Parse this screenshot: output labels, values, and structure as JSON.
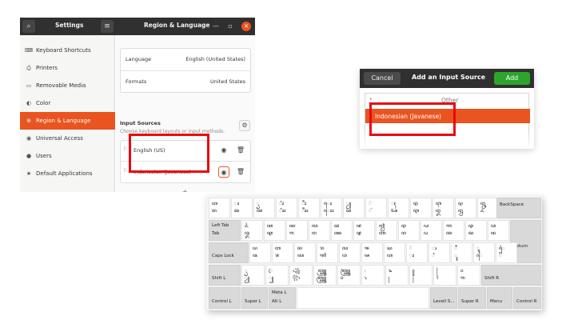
{
  "settings": {
    "header": {
      "left_title": "Settings",
      "right_title": "Region & Language",
      "search_glyph": "⌕",
      "menu_glyph": "≡",
      "minimize_glyph": "—",
      "maximize_glyph": "▫",
      "close_glyph": "✕"
    },
    "sidebar": {
      "items": [
        {
          "icon": "keyboard-icon",
          "glyph": "⌨",
          "label": "Keyboard Shortcuts"
        },
        {
          "icon": "printer-icon",
          "glyph": "⎙",
          "label": "Printers"
        },
        {
          "icon": "removable-media-icon",
          "glyph": "▭",
          "label": "Removable Media"
        },
        {
          "icon": "color-icon",
          "glyph": "◐",
          "label": "Color"
        },
        {
          "icon": "region-language-icon",
          "glyph": "⊕",
          "label": "Region & Language"
        },
        {
          "icon": "universal-access-icon",
          "glyph": "◉",
          "label": "Universal Access"
        },
        {
          "icon": "users-icon",
          "glyph": "●",
          "label": "Users"
        },
        {
          "icon": "default-applications-icon",
          "glyph": "★",
          "label": "Default Applications"
        }
      ],
      "active_index": 4
    },
    "language_row": {
      "label": "Language",
      "value": "English (United States)"
    },
    "formats_row": {
      "label": "Formats",
      "value": "United States"
    },
    "input_sources": {
      "title": "Input Sources",
      "subtitle": "Choose keyboard layouts or input methods.",
      "options_glyph": "⚙",
      "drag_glyph": "⠿",
      "sources": [
        {
          "name": "English (US)",
          "eye_glyph": "◉",
          "trash_glyph": "🗑"
        },
        {
          "name": "Indonesian (Javanese)",
          "eye_glyph": "◉",
          "trash_glyph": "🗑"
        }
      ],
      "add_glyph": "+"
    }
  },
  "dialog": {
    "cancel_label": "Cancel",
    "title": "Add an Input Source",
    "add_label": "Add",
    "back_glyph": "‹",
    "other_label": "Other",
    "selected_item": "Indonesian (Javanese)"
  },
  "keyboard": {
    "labels": {
      "backspace": "BackSpace",
      "tab_top": "Left Tab",
      "tab_bottom": "Tab",
      "return": "Return",
      "caps": "Caps Lock",
      "shift_l": "Shift L",
      "shift_r": "Shift R",
      "ctrl_l": "Control L",
      "super_l": "Super L",
      "meta_top": "Meta L",
      "meta_bottom": "Alt L",
      "level3": "LevelI S...",
      "super_r": "Super R",
      "menu": "Menu",
      "ctrl_r": "Control R"
    },
    "row1": [
      [
        "ꦲ",
        "ꦩ"
      ],
      [
        "ꦴ",
        "ꦢ"
      ],
      [
        "ꦽ",
        "ꦠ"
      ],
      [
        "ꦶꦴ",
        "ꦶꦴꦴ"
      ],
      [
        "ꦷꦴ",
        "ꦷꦴꦴ"
      ],
      [
        "ꦺꦴ",
        "ꦺꦴꦴ"
      ],
      [
        "ꦾ",
        "ꦕ"
      ],
      [
        "ꦁ",
        "ꦂ"
      ],
      [
        "ꦃ",
        "ꦄ"
      ],
      [
        "ꦅ",
        "ꦆ"
      ],
      [
        "ꦇ",
        "ꦈ"
      ],
      [
        "ꦉ",
        "ꦊ"
      ],
      [
        "ꦋ",
        "ꦌ"
      ]
    ],
    "row2": [
      [
        "ꦍ",
        "ꦎ"
      ],
      [
        "ꦏ",
        "ꦐ"
      ],
      [
        "ꦑ",
        "ꦒ"
      ],
      [
        "ꦓ",
        "ꦔ"
      ],
      [
        "ꦕ",
        "ꦖ"
      ],
      [
        "ꦗ",
        "ꦘ"
      ],
      [
        "ꦙ",
        "ꦚ"
      ],
      [
        "ꦛ",
        "ꦜ"
      ],
      [
        "ꦝ",
        "ꦞ"
      ],
      [
        "ꦟ",
        "ꦠ"
      ],
      [
        "ꦡ",
        "ꦢ"
      ],
      [
        "ꦣ",
        "ꦤ"
      ]
    ],
    "row3": [
      [
        "ꦥ",
        "ꦦ"
      ],
      [
        "ꦧ",
        "ꦨ"
      ],
      [
        "ꦩ",
        "ꦪ"
      ],
      [
        "ꦫ",
        "ꦬ"
      ],
      [
        "ꦭ",
        "ꦮ"
      ],
      [
        "ꦯ",
        "ꦰ"
      ],
      [
        "ꦱ",
        "ꦲ"
      ],
      [
        "꦳",
        "ꦴ"
      ],
      [
        "ꦵ",
        "ꦶ"
      ],
      [
        "ꦷ",
        "ꦸ"
      ],
      [
        "ꦹ",
        "ꦺ"
      ],
      [
        "ꦻ",
        "ꦼ"
      ]
    ],
    "row4": [
      [
        "ꦽ",
        "ꦾ"
      ],
      [
        "ꦿ",
        "꧀"
      ],
      [
        "꧁",
        "꧂"
      ],
      [
        "꧃",
        "꧄"
      ],
      [
        "꧅",
        "꧆"
      ],
      [
        "꧇",
        "꧈"
      ],
      [
        "꧉",
        "꧊"
      ],
      [
        "꧋",
        "꧌"
      ],
      [
        "꧍",
        "ꧏ"
      ],
      [
        "꧐",
        "꧑"
      ]
    ]
  }
}
